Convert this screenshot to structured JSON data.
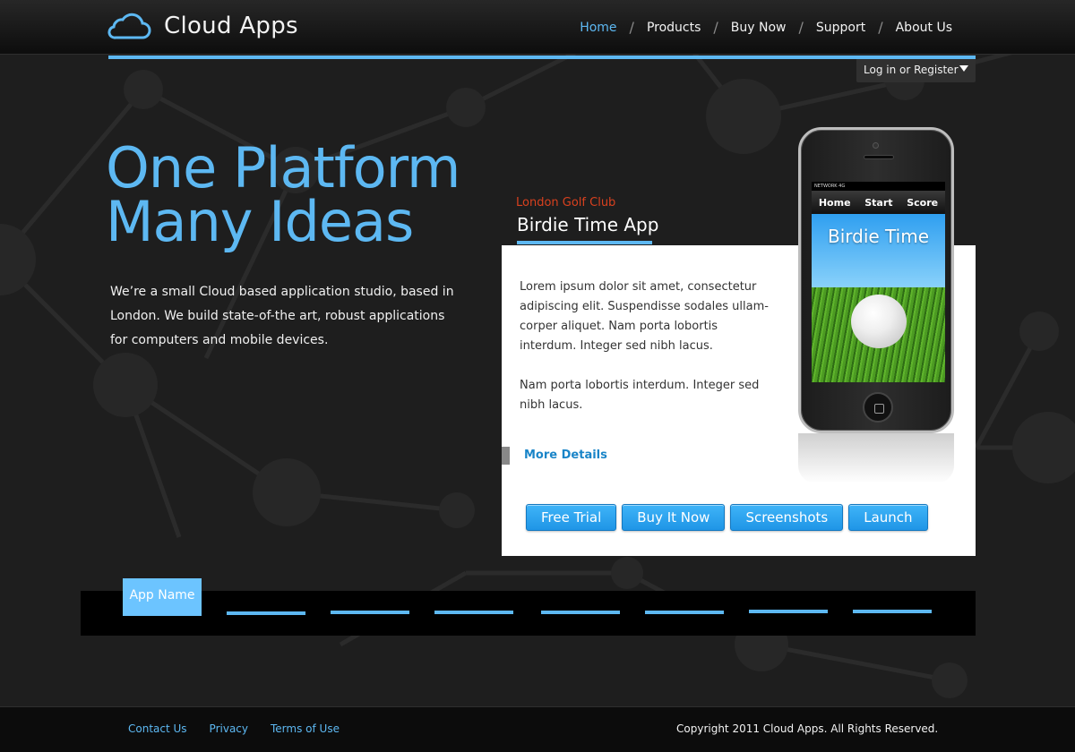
{
  "brand": {
    "name": "Cloud Apps",
    "icon": "cloud-icon",
    "accent": "#5db8f2"
  },
  "nav": {
    "items": [
      {
        "label": "Home",
        "active": true
      },
      {
        "label": "Products"
      },
      {
        "label": "Buy Now"
      },
      {
        "label": "Support"
      },
      {
        "label": "About Us"
      }
    ],
    "separator": "/"
  },
  "login": {
    "label": "Log in or Register",
    "icon": "caret-down-icon"
  },
  "hero": {
    "line1": "One Platform",
    "line2": "Many Ideas",
    "body": "We’re a small Cloud based application studio, based in London. We build state-of-the art, robust applications for computers and mobile devices."
  },
  "app": {
    "club": "London Golf Club",
    "title": "Birdie Time App",
    "paragraph1": "Lorem ipsum dolor sit amet, consectetur adipiscing elit. Suspendisse sodales ullam-corper aliquet. Nam porta lobortis interdum. Integer sed nibh lacus.",
    "paragraph2": "Nam porta lobortis interdum. Integer sed nibh lacus.",
    "more": "More Details",
    "buttons": [
      "Free Trial",
      "Buy It Now",
      "Screenshots",
      "Launch"
    ]
  },
  "phone": {
    "status": "NETWORK 4G",
    "tabs": [
      "Home",
      "Start",
      "Score"
    ],
    "screen_title": "Birdie Time"
  },
  "app_bar": {
    "selected": "App Name"
  },
  "footer": {
    "links": [
      "Contact Us",
      "Privacy",
      "Terms of Use"
    ],
    "copyright": "Copyright 2011 Cloud Apps. All Rights Reserved."
  }
}
